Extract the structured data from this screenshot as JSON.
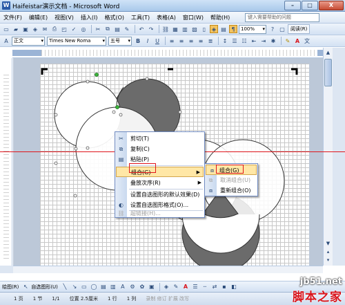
{
  "window": {
    "title": "Haifeistar演示文档 - Microsoft Word",
    "buttons": [
      "–",
      "□",
      "X"
    ]
  },
  "menubar": {
    "items": [
      "文件(F)",
      "编辑(E)",
      "视图(V)",
      "插入(I)",
      "格式(O)",
      "工具(T)",
      "表格(A)",
      "窗口(W)",
      "帮助(H)"
    ],
    "help_placeholder": "键入需要帮助的问题"
  },
  "standard_toolbar": {
    "zoom": "100%",
    "read_label": "阅读(R)"
  },
  "format_toolbar": {
    "style": "正文",
    "font": "Times New Roma",
    "size": "五号",
    "bold": "B",
    "italic": "I",
    "underline": "U",
    "font_color_letter": "A"
  },
  "context_menu": {
    "items": [
      {
        "label": "剪切(T)",
        "icon": "scissors-icon",
        "enabled": true
      },
      {
        "label": "复制(C)",
        "icon": "copy-icon",
        "enabled": true
      },
      {
        "label": "粘贴(P)",
        "icon": "paste-icon",
        "enabled": true
      },
      {
        "label": "组合(G)",
        "icon": "",
        "enabled": true,
        "submenu": true,
        "highlighted": true
      },
      {
        "label": "叠放次序(R)",
        "icon": "",
        "enabled": true,
        "submenu": true
      },
      {
        "label": "设置自选图形的默认效果(D)",
        "icon": "",
        "enabled": true
      },
      {
        "label": "设置自选图形格式(O)...",
        "icon": "format-shape-icon",
        "enabled": true
      },
      {
        "label": "超链接(H)...",
        "icon": "hyperlink-icon",
        "enabled": false
      }
    ]
  },
  "submenu": {
    "items": [
      {
        "label": "组合(G)",
        "icon": "group-icon",
        "enabled": true,
        "highlighted": true
      },
      {
        "label": "取消组合(U)",
        "icon": "ungroup-icon",
        "enabled": false
      },
      {
        "label": "重新组合(O)",
        "icon": "regroup-icon",
        "enabled": true
      }
    ]
  },
  "draw_toolbar": {
    "draw_label": "绘图(R)",
    "autoshape_label": "自选图形(U)"
  },
  "statusbar": {
    "page": "1 页",
    "section": "1 节",
    "pages": "1/1",
    "position": "位置 2.5厘米",
    "line": "1 行",
    "column": "1 列",
    "modes": "录制  修订  扩展  改写"
  },
  "watermark": {
    "url": "jb51.net",
    "text": "脚本之家"
  },
  "colors": {
    "highlight": "#ffe7a6",
    "annotation_red": "#e0141a",
    "circle_fill_dark": "#6b6b6b"
  }
}
